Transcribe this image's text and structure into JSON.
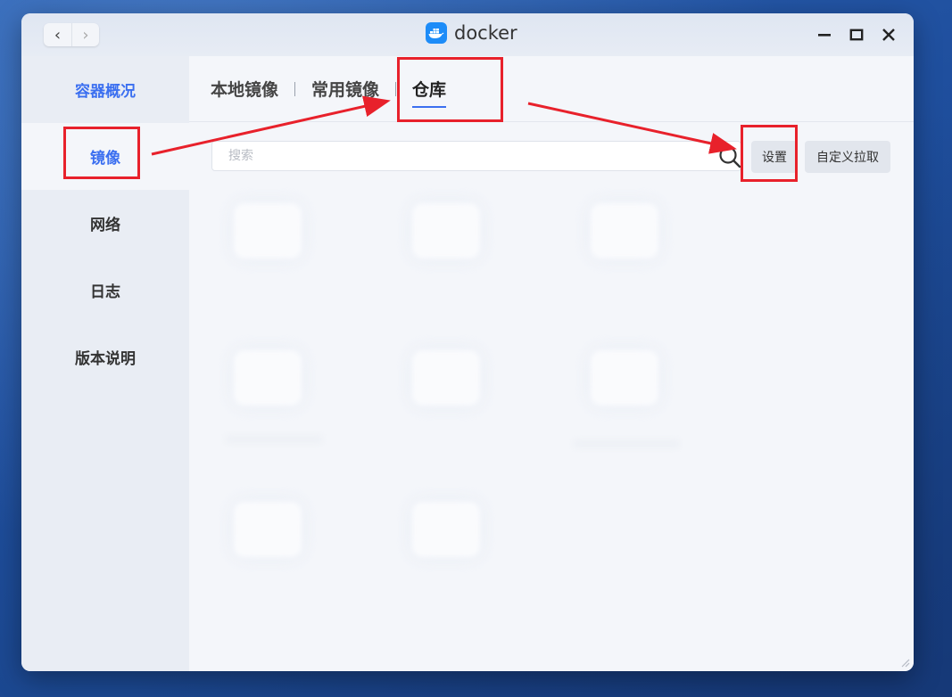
{
  "titlebar": {
    "back_symbol": "‹",
    "forward_symbol": "›",
    "app_icon": "docker-whale-icon",
    "app_name": "docker"
  },
  "window_controls": [
    "minimize-icon",
    "maximize-icon",
    "close-icon"
  ],
  "sidebar": {
    "items": [
      {
        "label": "容器概况"
      },
      {
        "label": "镜像"
      },
      {
        "label": "网络"
      },
      {
        "label": "日志"
      },
      {
        "label": "版本说明"
      }
    ]
  },
  "tabs": [
    {
      "label": "本地镜像"
    },
    {
      "label": "常用镜像"
    },
    {
      "label": "仓库"
    }
  ],
  "active_tab": "仓库",
  "search": {
    "placeholder": "搜索",
    "value": ""
  },
  "buttons": {
    "settings": "设置",
    "custom_pull": "自定义拉取"
  },
  "colors": {
    "accent": "#3b6ff0",
    "annotation": "#e8212b",
    "docker_blue": "#1d8cf8"
  }
}
